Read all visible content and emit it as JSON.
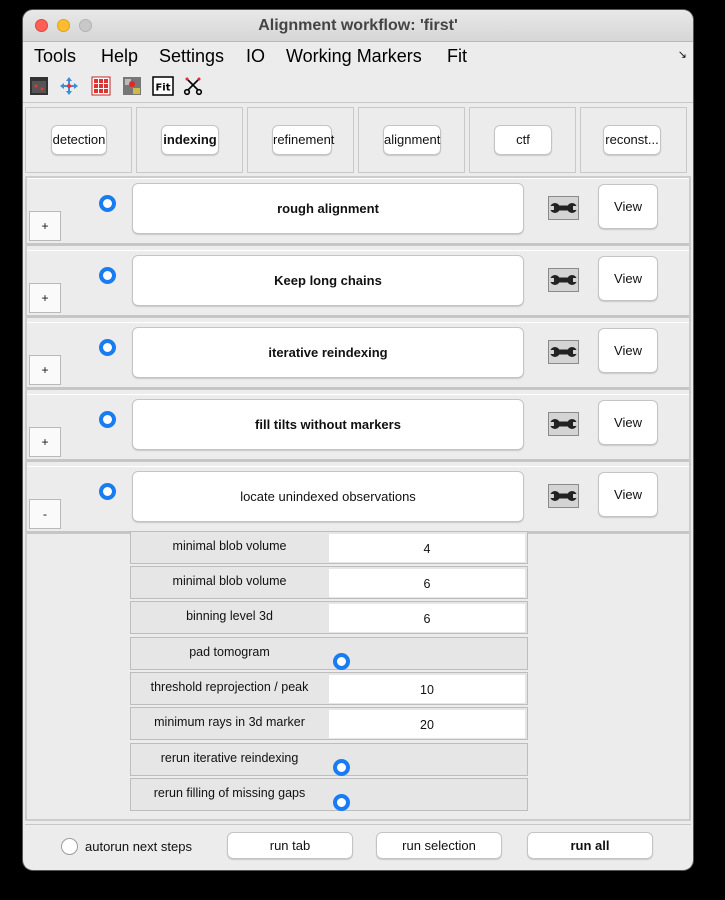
{
  "window": {
    "title": "Alignment workflow: 'first'"
  },
  "menu": [
    "Tools",
    "Help",
    "Settings",
    "IO",
    "Working Markers",
    "Fit"
  ],
  "toolbar": {
    "fit_label": "Fit"
  },
  "tabs": [
    "detection",
    "indexing",
    "refinement",
    "alignment",
    "ctf",
    "reconst..."
  ],
  "steps": [
    {
      "toggle": "+",
      "label": "rough alignment",
      "view": "View"
    },
    {
      "toggle": "+",
      "label": "Keep long chains",
      "view": "View"
    },
    {
      "toggle": "+",
      "label": "iterative reindexing",
      "view": "View"
    },
    {
      "toggle": "+",
      "label": "fill tilts without markers",
      "view": "View"
    },
    {
      "toggle": "-",
      "label": "locate unindexed observations",
      "view": "View"
    }
  ],
  "params": [
    {
      "label": "minimal blob volume",
      "value": "4"
    },
    {
      "label": "minimal blob volume",
      "value": "6"
    },
    {
      "label": "binning level 3d",
      "value": "6"
    },
    {
      "label": "pad tomogram"
    },
    {
      "label": "threshold reprojection / peak",
      "value": "10"
    },
    {
      "label": "minimum rays in 3d marker",
      "value": "20"
    },
    {
      "label": "rerun iterative reindexing"
    },
    {
      "label": "rerun filling of missing gaps"
    }
  ],
  "bottom": {
    "autorun_label": "autorun next steps",
    "run_tab": "run tab",
    "run_selection": "run selection",
    "run_all": "run all"
  },
  "colors": {
    "accent": "#1a7cf5"
  }
}
